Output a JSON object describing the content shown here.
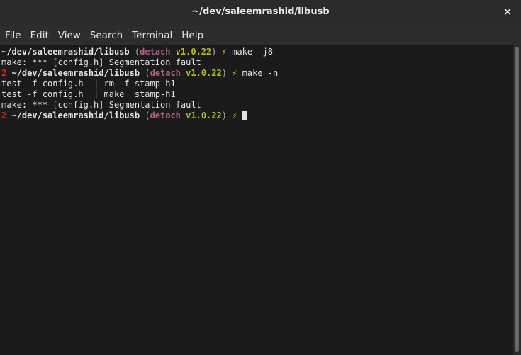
{
  "window": {
    "title": "~/dev/saleemrashid/libusb",
    "close_glyph": "✕"
  },
  "menu": {
    "items": [
      "File",
      "Edit",
      "View",
      "Search",
      "Terminal",
      "Help"
    ]
  },
  "terminal": {
    "colors": {
      "background": "#1b1b1b",
      "foreground": "#e4e4e4",
      "branch": "#b16286",
      "version": "#b8bb26",
      "bolt": "#fabd2f",
      "exit_code": "#cc241d"
    },
    "lines": [
      {
        "type": "prompt",
        "exit_code": "",
        "path": "~/dev/saleemrashid/libusb",
        "open_paren": "(",
        "branch": "detach",
        "version": "v1.0.22",
        "close_paren": ")",
        "bolt": "⚡",
        "command": "make -j8"
      },
      {
        "type": "output",
        "text": "make: *** [config.h] Segmentation fault"
      },
      {
        "type": "prompt",
        "exit_code": "2",
        "path": "~/dev/saleemrashid/libusb",
        "open_paren": "(",
        "branch": "detach",
        "version": "v1.0.22",
        "close_paren": ")",
        "bolt": "⚡",
        "command": "make -n"
      },
      {
        "type": "output",
        "text": "test -f config.h || rm -f stamp-h1"
      },
      {
        "type": "output",
        "text": "test -f config.h || make  stamp-h1"
      },
      {
        "type": "output",
        "text": "make: *** [config.h] Segmentation fault"
      },
      {
        "type": "prompt",
        "exit_code": "2",
        "path": "~/dev/saleemrashid/libusb",
        "open_paren": "(",
        "branch": "detach",
        "version": "v1.0.22",
        "close_paren": ")",
        "bolt": "⚡",
        "command": ""
      }
    ]
  }
}
